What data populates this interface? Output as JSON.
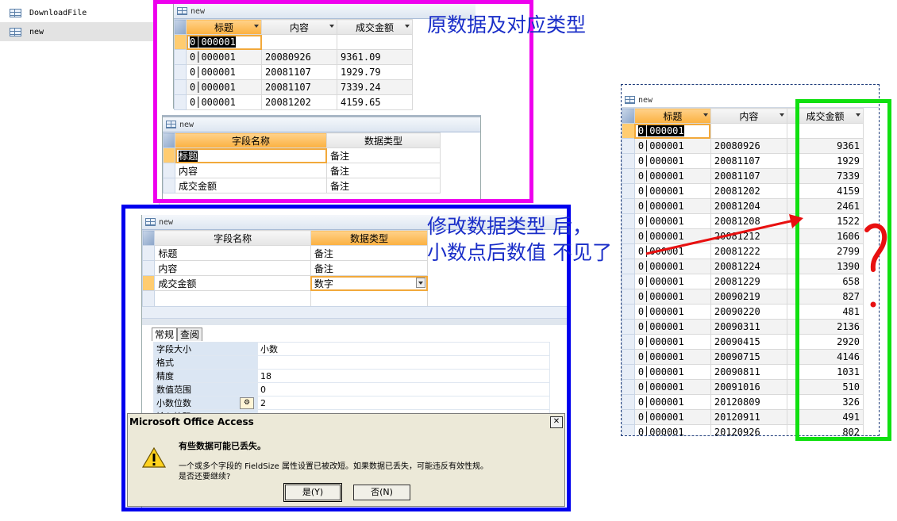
{
  "nav": {
    "items": [
      {
        "label": "DownloadFile"
      },
      {
        "label": "new"
      }
    ]
  },
  "original": {
    "window_title": "new",
    "headers": [
      "标题",
      "内容",
      "成交金额"
    ],
    "rows": [
      [
        "0│000001",
        "",
        ""
      ],
      [
        "0│000001",
        "20080926",
        "9361.09"
      ],
      [
        "0│000001",
        "20081107",
        "1929.79"
      ],
      [
        "0│000001",
        "20081107",
        "7339.24"
      ],
      [
        "0│000001",
        "20081202",
        "4159.65"
      ]
    ]
  },
  "design_top": {
    "window_title": "new",
    "headers": [
      "字段名称",
      "数据类型"
    ],
    "rows": [
      [
        "标题",
        "备注"
      ],
      [
        "内容",
        "备注"
      ],
      [
        "成交金额",
        "备注"
      ]
    ]
  },
  "design_bottom": {
    "window_title": "new",
    "headers": [
      "字段名称",
      "数据类型"
    ],
    "rows": [
      [
        "标题",
        "备注"
      ],
      [
        "内容",
        "备注"
      ],
      [
        "成交金额",
        "数字"
      ]
    ],
    "tabs": [
      "常规",
      "查阅"
    ],
    "props": [
      [
        "字段大小",
        "小数"
      ],
      [
        "格式",
        ""
      ],
      [
        "精度",
        "18"
      ],
      [
        "数值范围",
        "0"
      ],
      [
        "小数位数",
        "2"
      ],
      [
        "输入掩码",
        ""
      ]
    ]
  },
  "dialog": {
    "title": "Microsoft Office Access",
    "heading": "有些数据可能已丢失。",
    "message1": "一个或多个字段的 FieldSize 属性设置已被改短。如果数据已丢失，可能违反有效性规。",
    "message2": "是否还要继续?",
    "yes": "是(Y)",
    "no": "否(N)"
  },
  "annotations": {
    "original_label": "原数据及对应类型",
    "modified_line1": "修改数据类型 后，",
    "modified_line2": "小数点后数值 不见了"
  },
  "result": {
    "window_title": "new",
    "headers": [
      "标题",
      "内容",
      "成交金额"
    ],
    "rows": [
      [
        "0│000001",
        "",
        ""
      ],
      [
        "0│000001",
        "20080926",
        "9361"
      ],
      [
        "0│000001",
        "20081107",
        "1929"
      ],
      [
        "0│000001",
        "20081107",
        "7339"
      ],
      [
        "0│000001",
        "20081202",
        "4159"
      ],
      [
        "0│000001",
        "20081204",
        "2461"
      ],
      [
        "0│000001",
        "20081208",
        "1522"
      ],
      [
        "0│000001",
        "20081212",
        "1606"
      ],
      [
        "0│000001",
        "20081222",
        "2799"
      ],
      [
        "0│000001",
        "20081224",
        "1390"
      ],
      [
        "0│000001",
        "20081229",
        "658"
      ],
      [
        "0│000001",
        "20090219",
        "827"
      ],
      [
        "0│000001",
        "20090220",
        "481"
      ],
      [
        "0│000001",
        "20090311",
        "2136"
      ],
      [
        "0│000001",
        "20090415",
        "2920"
      ],
      [
        "0│000001",
        "20090715",
        "4146"
      ],
      [
        "0│000001",
        "20090811",
        "1031"
      ],
      [
        "0│000001",
        "20091016",
        "510"
      ],
      [
        "0│000001",
        "20120809",
        "326"
      ],
      [
        "0│000001",
        "20120911",
        "491"
      ],
      [
        "0│000001",
        "20120926",
        "802"
      ]
    ]
  },
  "colors": {
    "magenta_frame": "#ee00ee",
    "blue_frame": "#0000ee",
    "green_frame": "#10e010",
    "annotation_text": "#1a2ec8",
    "arrow": "#e81010",
    "header_orange": "#fbb040"
  },
  "icons": {
    "table": "table-icon",
    "warning": "warning-icon",
    "close": "close-icon",
    "dropdown": "dropdown-arrow-icon",
    "builder": "builder-icon"
  }
}
